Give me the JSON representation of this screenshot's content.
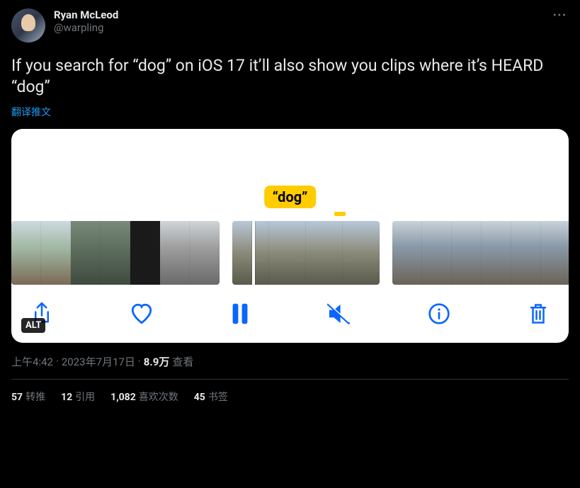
{
  "author": {
    "display_name": "Ryan McLeod",
    "handle": "@warpling"
  },
  "body": "If you search for “dog” on iOS 17 it’ll also show you clips where it’s HEARD “dog”",
  "translate_label": "翻译推文",
  "media": {
    "caption": "“dog”",
    "alt_badge": "ALT"
  },
  "meta": {
    "time": "上午4:42",
    "sep": " · ",
    "date": "2023年7月17日",
    "views_num": "8.9万",
    "views_label": " 查看"
  },
  "stats": {
    "retweets_num": "57",
    "retweets_label": "转推",
    "quotes_num": "12",
    "quotes_label": "引用",
    "likes_num": "1,082",
    "likes_label": "喜欢次数",
    "bookmarks_num": "45",
    "bookmarks_label": "书签"
  }
}
